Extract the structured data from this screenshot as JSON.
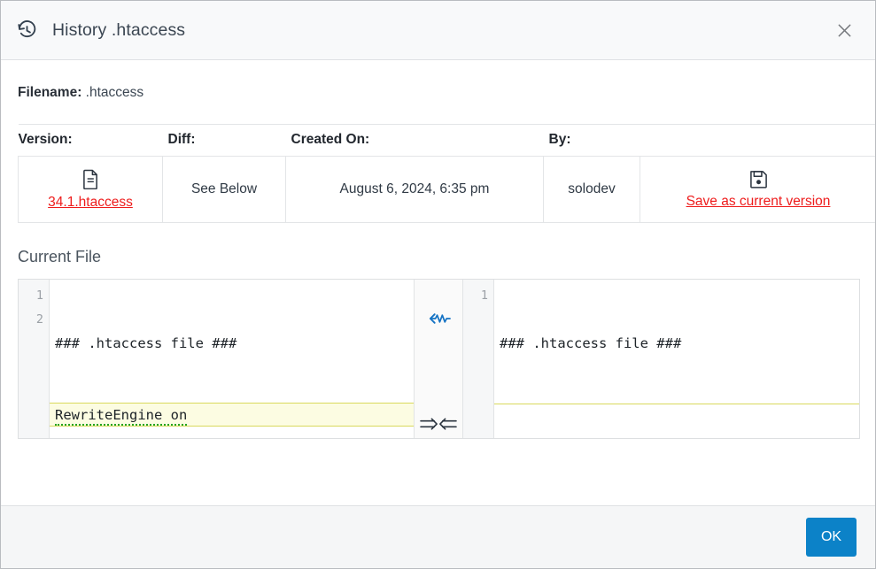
{
  "header": {
    "icon": "history-icon",
    "title": "History .htaccess",
    "close_icon": "close-icon"
  },
  "filename_row": {
    "label": "Filename:",
    "value": " .htaccess"
  },
  "version_table": {
    "columns": [
      "Version:",
      "Diff:",
      "Created On:",
      "By:",
      ""
    ],
    "rows": [
      {
        "version_icon": "document-icon",
        "version_link": "34.1.htaccess",
        "diff": "See Below",
        "created_on": "August 6, 2024, 6:35 pm",
        "by": "solodev",
        "action_icon": "floppy-save-icon",
        "action_link": "Save as current version"
      }
    ]
  },
  "current_file": {
    "section_title": "Current File",
    "left_pane": {
      "line_numbers": [
        "1",
        "2"
      ],
      "lines": [
        {
          "text": "### .htaccess file ###",
          "changed": false,
          "spellcheck": false
        },
        {
          "text": "RewriteEngine on",
          "changed": true,
          "spellcheck": true
        }
      ]
    },
    "middle": {
      "copy_left_icon": "copy-to-left-arrow-icon",
      "collapse_icon": "collapse-arrows-icon"
    },
    "right_pane": {
      "line_numbers": [
        "1"
      ],
      "lines": [
        {
          "text": "### .htaccess file ###",
          "changed": false,
          "spellcheck": false
        }
      ]
    }
  },
  "footer": {
    "ok_label": "OK"
  },
  "colors": {
    "accent_blue": "#0c82c8",
    "link_red": "#ee1c1c",
    "diff_highlight": "#fcfce2",
    "diff_border": "#d9d95c",
    "spellcheck_green": "#22a522",
    "arrow_blue": "#1573c4"
  }
}
